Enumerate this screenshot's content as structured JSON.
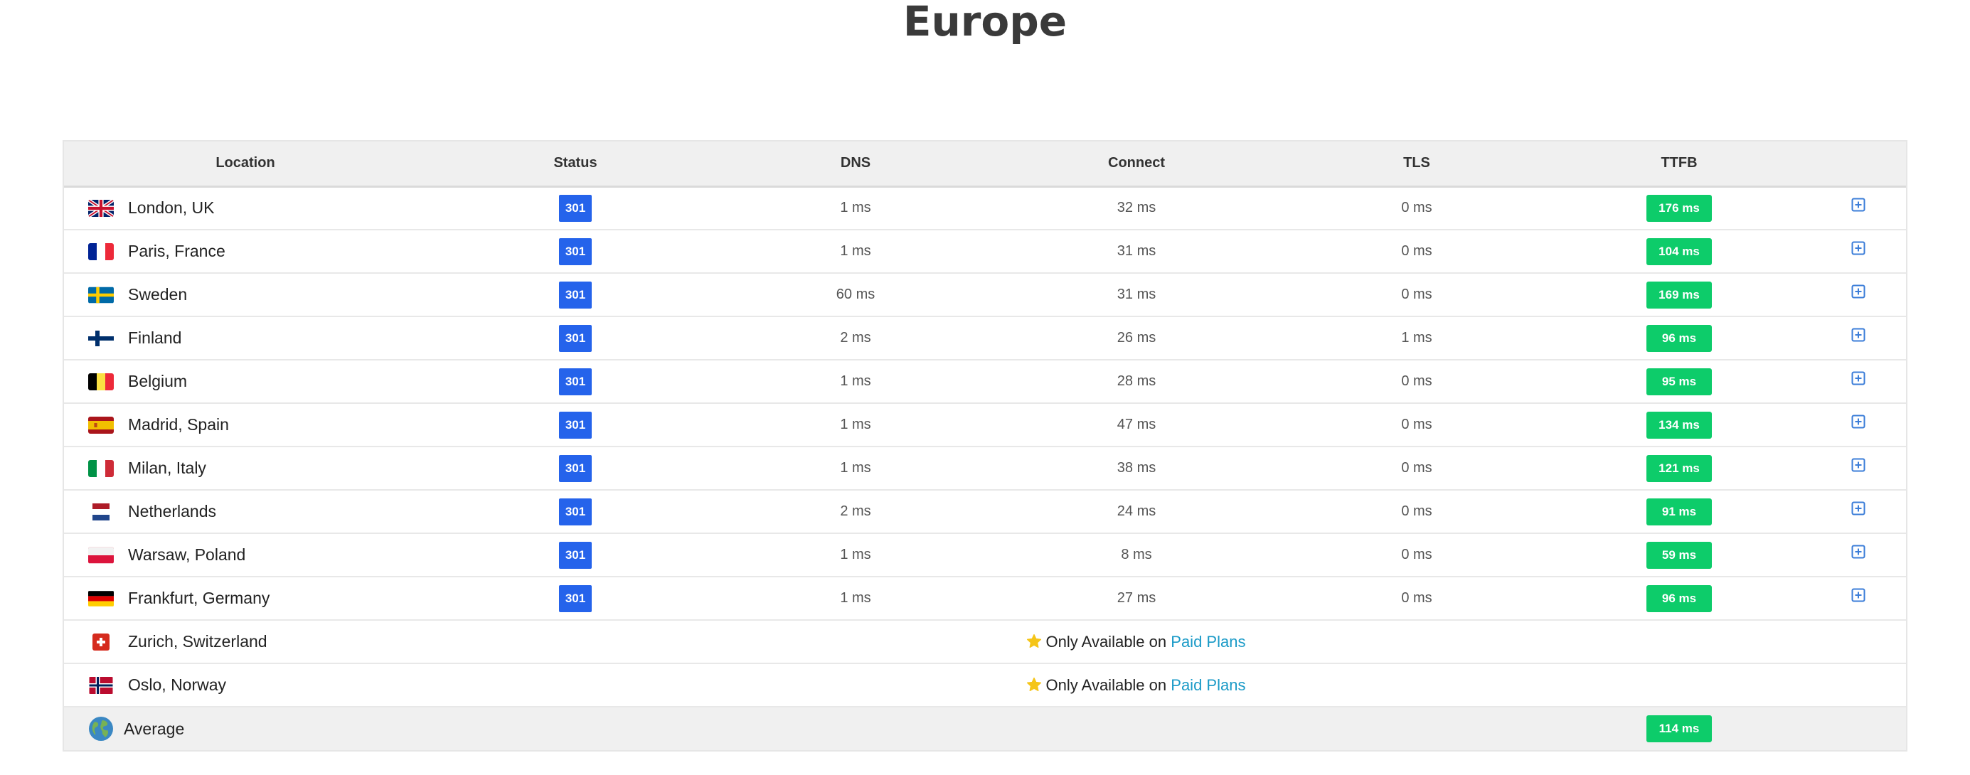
{
  "title": "Europe",
  "columns": {
    "location": "Location",
    "status": "Status",
    "dns": "DNS",
    "connect": "Connect",
    "tls": "TLS",
    "ttfb": "TTFB"
  },
  "rows": [
    {
      "location": "London, UK",
      "flag": "uk-flag-icon",
      "status": "301",
      "dns": "1 ms",
      "connect": "32 ms",
      "tls": "0 ms",
      "ttfb": "176 ms"
    },
    {
      "location": "Paris, France",
      "flag": "france-flag-icon",
      "status": "301",
      "dns": "1 ms",
      "connect": "31 ms",
      "tls": "0 ms",
      "ttfb": "104 ms"
    },
    {
      "location": "Sweden",
      "flag": "sweden-flag-icon",
      "status": "301",
      "dns": "60 ms",
      "connect": "31 ms",
      "tls": "0 ms",
      "ttfb": "169 ms"
    },
    {
      "location": "Finland",
      "flag": "finland-flag-icon",
      "status": "301",
      "dns": "2 ms",
      "connect": "26 ms",
      "tls": "1 ms",
      "ttfb": "96 ms"
    },
    {
      "location": "Belgium",
      "flag": "belgium-flag-icon",
      "status": "301",
      "dns": "1 ms",
      "connect": "28 ms",
      "tls": "0 ms",
      "ttfb": "95 ms"
    },
    {
      "location": "Madrid, Spain",
      "flag": "spain-flag-icon",
      "status": "301",
      "dns": "1 ms",
      "connect": "47 ms",
      "tls": "0 ms",
      "ttfb": "134 ms"
    },
    {
      "location": "Milan, Italy",
      "flag": "italy-flag-icon",
      "status": "301",
      "dns": "1 ms",
      "connect": "38 ms",
      "tls": "0 ms",
      "ttfb": "121 ms"
    },
    {
      "location": "Netherlands",
      "flag": "netherlands-flag-icon",
      "status": "301",
      "dns": "2 ms",
      "connect": "24 ms",
      "tls": "0 ms",
      "ttfb": "91 ms"
    },
    {
      "location": "Warsaw, Poland",
      "flag": "poland-flag-icon",
      "status": "301",
      "dns": "1 ms",
      "connect": "8 ms",
      "tls": "0 ms",
      "ttfb": "59 ms"
    },
    {
      "location": "Frankfurt, Germany",
      "flag": "germany-flag-icon",
      "status": "301",
      "dns": "1 ms",
      "connect": "27 ms",
      "tls": "0 ms",
      "ttfb": "96 ms"
    }
  ],
  "paid_rows": [
    {
      "location": "Zurich, Switzerland",
      "flag": "switzerland-flag-icon",
      "text": "Only Available on",
      "link": "Paid Plans"
    },
    {
      "location": "Oslo, Norway",
      "flag": "norway-flag-icon",
      "text": "Only Available on",
      "link": "Paid Plans"
    }
  ],
  "average": {
    "label": "Average",
    "icon": "globe-icon",
    "ttfb": "114 ms"
  },
  "colors": {
    "status_badge": "#2563eb",
    "ttfb_badge": "#0dcc6a",
    "link": "#1a9ac7",
    "expand_icon": "#3b7dd8",
    "star": "#f5c518",
    "header_bg": "#f0f0f0"
  }
}
